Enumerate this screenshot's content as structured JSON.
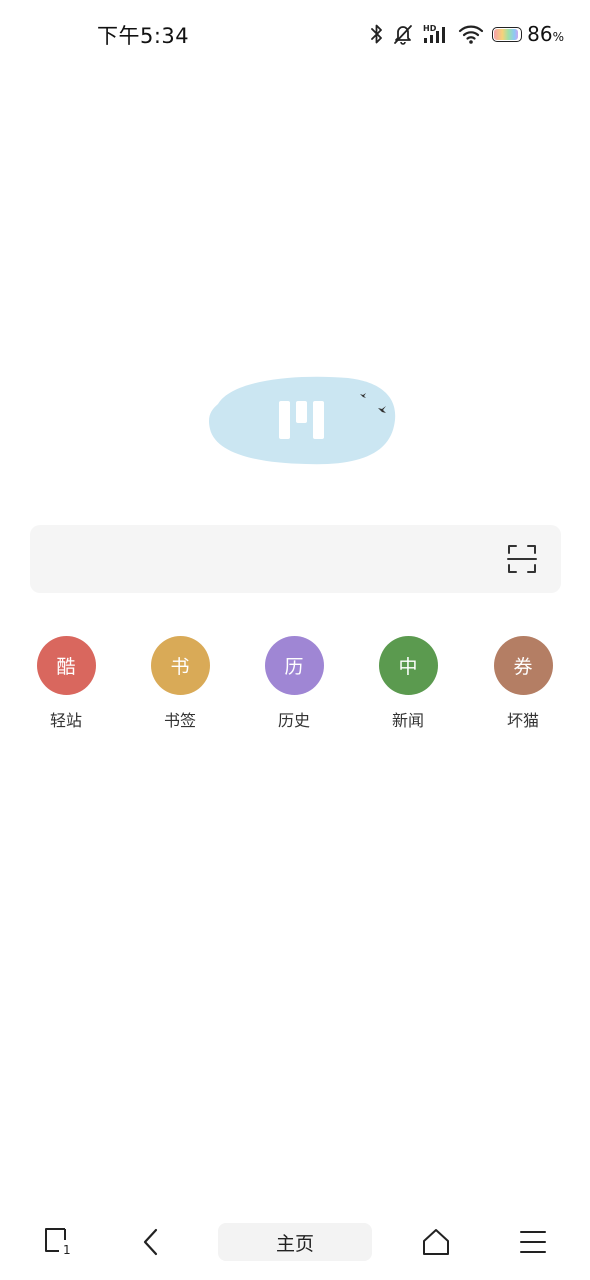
{
  "status_bar": {
    "time": "下午5:34",
    "battery_percent": "86",
    "battery_unit": "%",
    "icons": [
      "bluetooth-icon",
      "mute-bell-icon",
      "hd-signal-icon",
      "wifi-icon",
      "battery-icon"
    ]
  },
  "logo": {
    "icon": "cloud-logo-icon",
    "color": "#cbe6f2"
  },
  "search": {
    "value": "",
    "scan_icon": "scan-icon"
  },
  "shortcuts": [
    {
      "icon_char": "酷",
      "label": "轻站",
      "color": "#d9675e"
    },
    {
      "icon_char": "书",
      "label": "书签",
      "color": "#d9aa57"
    },
    {
      "icon_char": "历",
      "label": "历史",
      "color": "#9f86d4"
    },
    {
      "icon_char": "中",
      "label": "新闻",
      "color": "#5b9a4f"
    },
    {
      "icon_char": "券",
      "label": "坏猫",
      "color": "#b47e64"
    }
  ],
  "bottom_nav": {
    "tabs_icon": "tabs-icon",
    "tabs_count": "1",
    "back_icon": "back-icon",
    "home_label": "主页",
    "home_icon": "home-icon",
    "menu_icon": "menu-icon"
  }
}
